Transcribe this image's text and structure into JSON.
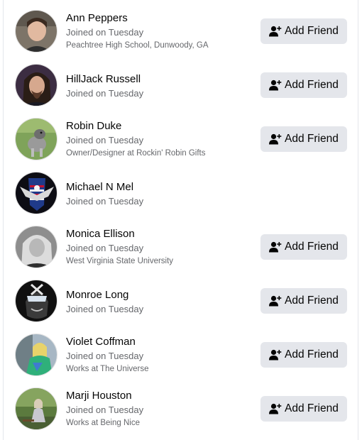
{
  "people": [
    {
      "name": "Ann Peppers",
      "joined": "Joined on Tuesday",
      "detail": "Peachtree High School, Dunwoody, GA",
      "button": "Add Friend",
      "avatar_icon": "profile-photo-woman-icon"
    },
    {
      "name": "HillJack Russell",
      "joined": "Joined on Tuesday",
      "detail": "",
      "button": "Add Friend",
      "avatar_icon": "profile-photo-long-hair-icon"
    },
    {
      "name": "Robin Duke",
      "joined": "Joined on Tuesday",
      "detail": "Owner/Designer at Rockin' Robin Gifts",
      "button": "Add Friend",
      "avatar_icon": "profile-photo-dog-icon"
    },
    {
      "name": "Michael N Mel",
      "joined": "Joined on Tuesday",
      "detail": "",
      "button": "",
      "avatar_icon": "profile-photo-eagle-flag-icon"
    },
    {
      "name": "Monica Ellison",
      "joined": "Joined on Tuesday",
      "detail": "West Virginia State University",
      "button": "Add Friend",
      "avatar_icon": "profile-photo-grayscale-woman-icon"
    },
    {
      "name": "Monroe Long",
      "joined": "Joined on Tuesday",
      "detail": "",
      "button": "Add Friend",
      "avatar_icon": "profile-photo-cartoon-hero-icon"
    },
    {
      "name": "Violet Coffman",
      "joined": "Joined on Tuesday",
      "detail": "Works at The Universe",
      "button": "Add Friend",
      "avatar_icon": "profile-photo-colorful-icon"
    },
    {
      "name": "Marji Houston",
      "joined": "Joined on Tuesday",
      "detail": "Works at Being Nice",
      "button": "Add Friend",
      "avatar_icon": "profile-photo-outdoor-icon"
    }
  ],
  "colors": {
    "button_bg": "#e4e6eb",
    "primary_text": "#050505",
    "secondary_text": "#65676b"
  }
}
